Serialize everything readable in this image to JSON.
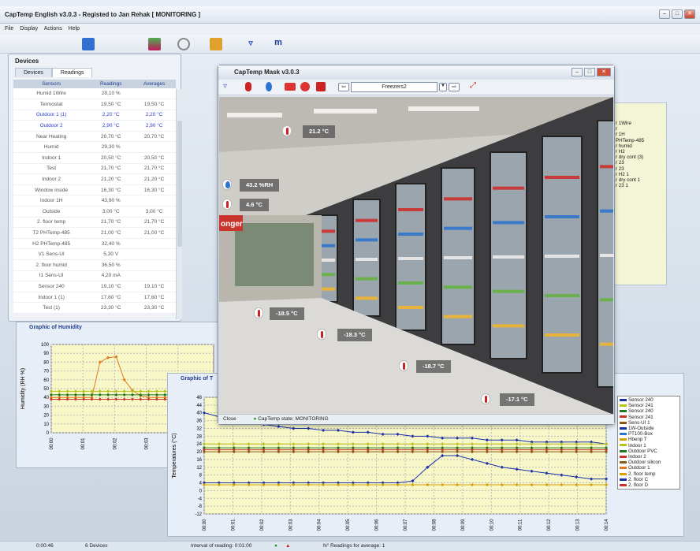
{
  "app": {
    "title": "CapTemp English v3.0.3   - Registed to Jan Rehak    [ MONITORING ]"
  },
  "menu": [
    "File",
    "Display",
    "Actions",
    "Help"
  ],
  "devices_panel": {
    "title": "Devices",
    "tabs": [
      "Devices",
      "Readings"
    ],
    "columns": [
      "Sensors",
      "Readings",
      "Averages"
    ],
    "rows": [
      {
        "sensor": "Humid 1Wire",
        "reading": "28,10 %",
        "average": "",
        "blue": false
      },
      {
        "sensor": "Termostat",
        "reading": "19,50 °C",
        "average": "19,50 °C",
        "blue": false
      },
      {
        "sensor": "Outdoor 1 (1)",
        "reading": "2,20 °C",
        "average": "2,20 °C",
        "blue": true
      },
      {
        "sensor": "Outdoor 2",
        "reading": "2,90 °C",
        "average": "2,90 °C",
        "blue": true
      },
      {
        "sensor": "Near Heating",
        "reading": "20,70 °C",
        "average": "20,70 °C",
        "blue": false
      },
      {
        "sensor": "Humid",
        "reading": "29,30 %",
        "average": "",
        "blue": false
      },
      {
        "sensor": "Indoor 1",
        "reading": "20,50 °C",
        "average": "20,50 °C",
        "blue": false
      },
      {
        "sensor": "Test",
        "reading": "21,70 °C",
        "average": "21,70 °C",
        "blue": false
      },
      {
        "sensor": "Indoor 2",
        "reading": "21,20 °C",
        "average": "21,20 °C",
        "blue": false
      },
      {
        "sensor": "Window inside",
        "reading": "16,30 °C",
        "average": "16,30 °C",
        "blue": false
      },
      {
        "sensor": "Indoor 1H",
        "reading": "43,90 %",
        "average": "",
        "blue": false
      },
      {
        "sensor": "Outside",
        "reading": "3,00 °C",
        "average": "3,00 °C",
        "blue": false
      },
      {
        "sensor": "2. floor temp",
        "reading": "21,70 °C",
        "average": "21,70 °C",
        "blue": false
      },
      {
        "sensor": "T2 PHTemp-485",
        "reading": "21,00 °C",
        "average": "21,00 °C",
        "blue": false
      },
      {
        "sensor": "H2 PHTemp-485",
        "reading": "32,40 %",
        "average": "",
        "blue": false
      },
      {
        "sensor": "V1 Sens-UI",
        "reading": "5,30 V",
        "average": "",
        "blue": false
      },
      {
        "sensor": "2. floor humid",
        "reading": "36,50 %",
        "average": "",
        "blue": false
      },
      {
        "sensor": "I1 Sens-UI",
        "reading": "4,20 mA",
        "average": "",
        "blue": false
      },
      {
        "sensor": "Sensor 240",
        "reading": "19,10 °C",
        "average": "19,10 °C",
        "blue": false
      },
      {
        "sensor": "Indoor 1 (1)",
        "reading": "17,60 °C",
        "average": "17,60 °C",
        "blue": false
      },
      {
        "sensor": "Test (1)",
        "reading": "23,30 °C",
        "average": "23,30 °C",
        "blue": false
      }
    ]
  },
  "mask_window": {
    "title": "CapTemp Mask   v3.0.3",
    "selected_mask": "Freezers2",
    "close_label": "Close",
    "status": "CapTemp state: MONITORING",
    "tags": [
      "21.2 °C",
      "43.2 %RH",
      "4.6 °C",
      "-18.5 °C",
      "-18.3 °C",
      "-18.7 °C",
      "-17.1 °C"
    ],
    "store_sign": "onger"
  },
  "right_panel": {
    "lines": [
      "r 1Wire",
      "r",
      "r 1H",
      "PHTemp-485",
      "r humid",
      "r H2",
      "r dry cont (3)",
      "r 23",
      "r 23",
      "r H2 1",
      "r dry cont 1",
      "r 23 1"
    ]
  },
  "humidity_graph": {
    "title": "Graphic of Humidity",
    "ylabel": "Humidity (RH %)"
  },
  "temp_graph": {
    "title": "Graphic of T",
    "ylabel": "Temperatures (°C)"
  },
  "chart_data": [
    {
      "type": "line",
      "title": "Graphic of Humidity",
      "ylabel": "Humidity (RH %)",
      "ylim": [
        0,
        100
      ],
      "x": [
        "00:00",
        "00:01",
        "00:02",
        "00:03",
        "00:04"
      ],
      "yticks": [
        0,
        10,
        20,
        30,
        40,
        50,
        60,
        70,
        80,
        90,
        100
      ],
      "series": [
        {
          "color": "#e07a1c",
          "values": [
            40,
            40,
            40,
            40,
            40,
            40,
            80,
            85,
            86,
            60,
            48,
            42,
            40,
            40,
            40,
            40,
            40,
            40,
            40,
            40,
            40
          ]
        },
        {
          "color": "#b7c219",
          "values": [
            47,
            47,
            47,
            47,
            47,
            47,
            47,
            47,
            47,
            47,
            47,
            47,
            47,
            47,
            47,
            47,
            47,
            47,
            47,
            47,
            47
          ]
        },
        {
          "color": "#1f7a1f",
          "values": [
            43,
            43,
            43,
            43,
            43,
            43,
            43,
            43,
            43,
            43,
            43,
            43,
            43,
            43,
            43,
            43,
            43,
            43,
            43,
            43,
            43
          ]
        },
        {
          "color": "#c8322a",
          "values": [
            38,
            38,
            38,
            38,
            38,
            38,
            38,
            38,
            38,
            38,
            38,
            38,
            38,
            38,
            38,
            38,
            38,
            38,
            38,
            38,
            38
          ]
        }
      ]
    },
    {
      "type": "line",
      "title": "Graphic of T",
      "ylabel": "Temperatures (°C)",
      "ylim": [
        -12,
        48
      ],
      "x": [
        "00:00",
        "00:01",
        "00:02",
        "00:03",
        "00:04",
        "00:05",
        "00:06",
        "00:07",
        "00:08",
        "00:09",
        "00:10",
        "00:11",
        "00:12",
        "00:13",
        "00:14"
      ],
      "yticks": [
        -12,
        -8,
        -4,
        0,
        4,
        8,
        12,
        16,
        20,
        24,
        28,
        32,
        36,
        40,
        44,
        48
      ],
      "legend": [
        "Sensor 240",
        "Sensor 241",
        "Sensor 240",
        "Sensor 241",
        "Sens-UI 1",
        "1W-Outside",
        "PT100-Box",
        "Hbenp T",
        "Indoor 1",
        "Outdoor PVC",
        "Indoor 2",
        "Outdoor silicon",
        "Outdoor 1",
        "2. floor temp",
        "2. floor C",
        "2. floor D"
      ],
      "series": [
        {
          "color": "#1b2fa8",
          "values": [
            40,
            38,
            36,
            35,
            34,
            33,
            32,
            32,
            31,
            31,
            30,
            30,
            29,
            29,
            28,
            28,
            27,
            27,
            27,
            26,
            26,
            26,
            25,
            25,
            25,
            25,
            25,
            24
          ]
        },
        {
          "color": "#1b2fa8",
          "values": [
            4,
            4,
            4,
            4,
            4,
            4,
            4,
            4,
            4,
            4,
            4,
            4,
            4,
            4,
            5,
            12,
            18,
            18,
            16,
            14,
            12,
            11,
            10,
            9,
            8,
            7,
            6,
            6
          ]
        },
        {
          "color": "#b7c219",
          "values": [
            24,
            24,
            24,
            24,
            24,
            24,
            24,
            24,
            24,
            24,
            24,
            24,
            24,
            24,
            24,
            24,
            24,
            24,
            24,
            24,
            24,
            24,
            24,
            24,
            24,
            24,
            24,
            24
          ]
        },
        {
          "color": "#1f7a1f",
          "values": [
            22,
            22,
            22,
            22,
            22,
            22,
            22,
            22,
            22,
            22,
            22,
            22,
            22,
            22,
            22,
            22,
            22,
            22,
            22,
            22,
            22,
            22,
            22,
            22,
            22,
            22,
            22,
            22
          ]
        },
        {
          "color": "#c8322a",
          "values": [
            21,
            21,
            21,
            21,
            21,
            21,
            21,
            21,
            21,
            21,
            21,
            21,
            21,
            21,
            21,
            21,
            21,
            21,
            21,
            21,
            21,
            21,
            21,
            21,
            21,
            21,
            21,
            21
          ]
        },
        {
          "color": "#8a5a14",
          "values": [
            20,
            20,
            20,
            20,
            20,
            20,
            20,
            20,
            20,
            20,
            20,
            20,
            20,
            20,
            20,
            20,
            20,
            20,
            20,
            20,
            20,
            20,
            20,
            20,
            20,
            20,
            20,
            20
          ]
        },
        {
          "color": "#d9a000",
          "values": [
            3,
            3,
            3,
            3,
            3,
            3,
            3,
            3,
            3,
            3,
            3,
            3,
            3,
            3,
            3,
            3,
            3,
            3,
            3,
            3,
            3,
            3,
            3,
            3,
            3,
            3,
            3,
            3
          ]
        }
      ]
    }
  ],
  "status_bar": {
    "time": "0:00:46",
    "devices": "6 Devices",
    "interval": "Interval of reading: 0:01:00",
    "nreadings": "N° Readings for average: 1"
  }
}
